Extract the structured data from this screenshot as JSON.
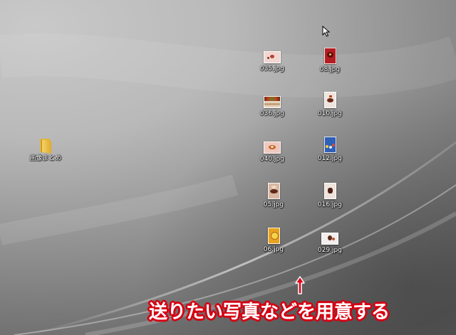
{
  "desktop": {
    "wallpaper": {
      "base_color": "#8e8e8e",
      "highlight_color": "#ffffff"
    },
    "folder": {
      "label": "画像まとめ",
      "icon": "folder-icon",
      "color": "#e7b637"
    },
    "files": [
      {
        "label": "035.jpg",
        "icon": "image-thumbnail-icon"
      },
      {
        "label": "08.jpg",
        "icon": "image-thumbnail-icon"
      },
      {
        "label": "036.jpg",
        "icon": "image-thumbnail-icon"
      },
      {
        "label": "010.jpg",
        "icon": "image-thumbnail-icon"
      },
      {
        "label": "040.jpg",
        "icon": "image-thumbnail-icon"
      },
      {
        "label": "012.jpg",
        "icon": "image-thumbnail-icon"
      },
      {
        "label": "05.jpg",
        "icon": "image-thumbnail-icon"
      },
      {
        "label": "016.jpg",
        "icon": "image-thumbnail-icon"
      },
      {
        "label": "06.jpg",
        "icon": "image-thumbnail-icon"
      },
      {
        "label": "029.jpg",
        "icon": "image-thumbnail-icon"
      }
    ]
  },
  "annotation": {
    "text": "送りたい写真などを用意する",
    "arrow": "up-arrow-icon",
    "text_color": "#ffffff",
    "outline_color": "#d50012"
  },
  "cursor": {
    "icon": "mouse-pointer-icon"
  }
}
